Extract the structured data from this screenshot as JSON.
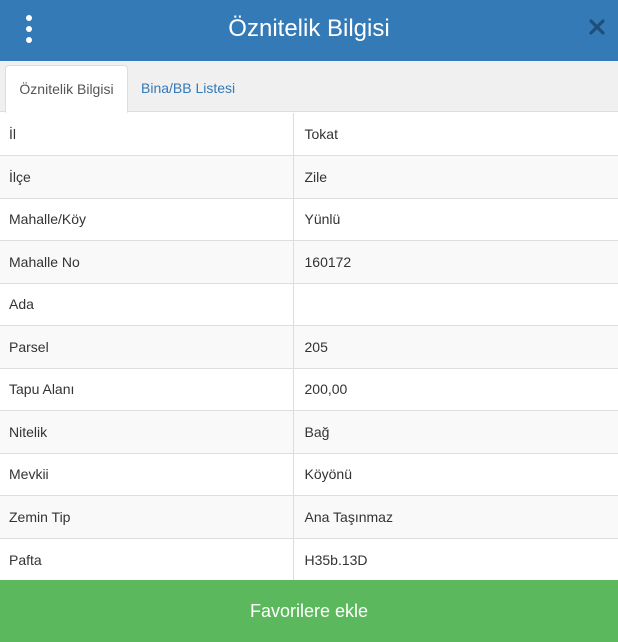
{
  "header": {
    "title": "Öznitelik Bilgisi",
    "menu_icon": "vertical-ellipsis-icon",
    "close_icon": "close-icon",
    "background_color": "#337ab7"
  },
  "tabs": [
    {
      "label": "Öznitelik Bilgisi",
      "active": true
    },
    {
      "label": "Bina/BB Listesi",
      "active": false
    }
  ],
  "attributes": [
    {
      "key": "İl",
      "value": "Tokat"
    },
    {
      "key": "İlçe",
      "value": "Zile"
    },
    {
      "key": "Mahalle/Köy",
      "value": "Yünlü"
    },
    {
      "key": "Mahalle No",
      "value": "160172"
    },
    {
      "key": "Ada",
      "value": ""
    },
    {
      "key": "Parsel",
      "value": "205"
    },
    {
      "key": "Tapu Alanı",
      "value": "200,00"
    },
    {
      "key": "Nitelik",
      "value": "Bağ"
    },
    {
      "key": "Mevkii",
      "value": "Köyönü"
    },
    {
      "key": "Zemin Tip",
      "value": "Ana Taşınmaz"
    },
    {
      "key": "Pafta",
      "value": "H35b.13D"
    }
  ],
  "footer": {
    "favorite_label": "Favorilere ekle",
    "button_color": "#5cb85c"
  }
}
